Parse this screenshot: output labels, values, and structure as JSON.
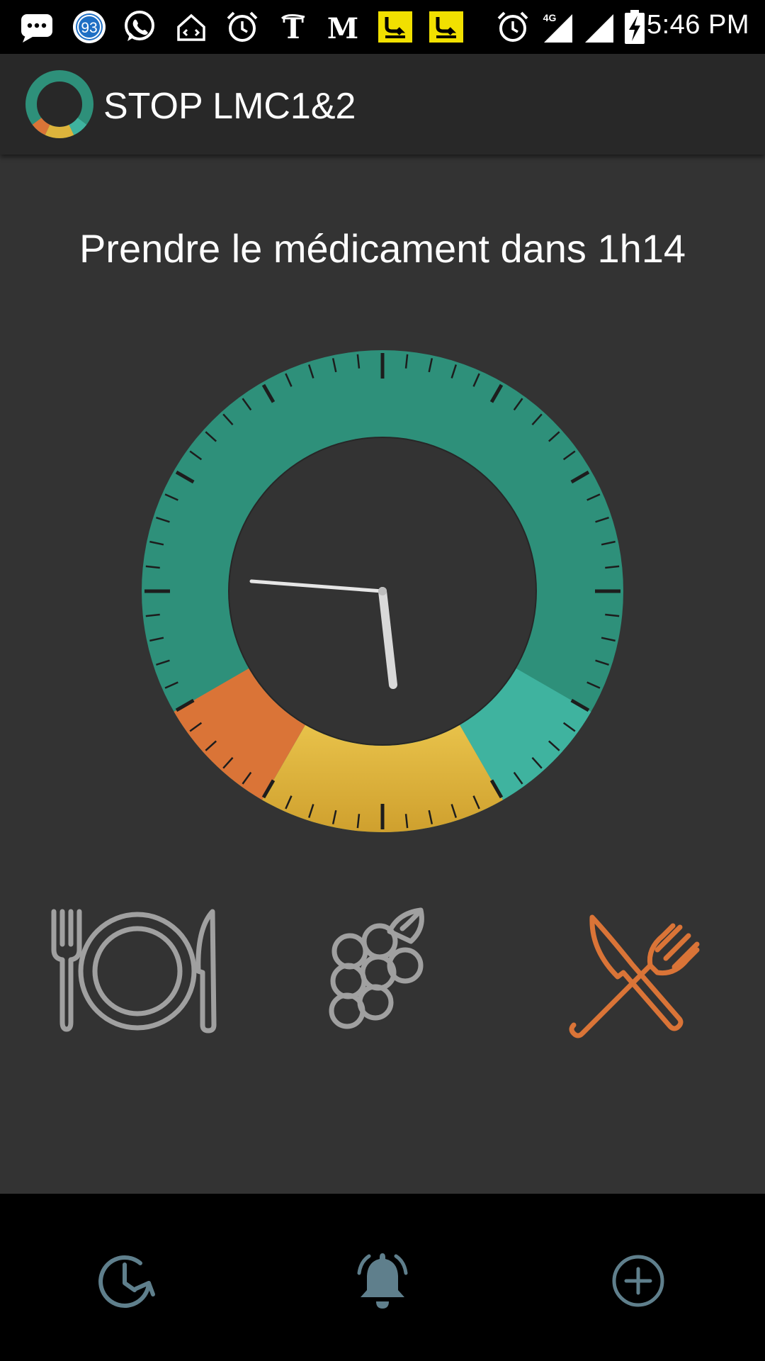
{
  "status_bar": {
    "time": "5:46 PM",
    "notification_badge": "93",
    "network": "4G",
    "icons": [
      "messaging-icon",
      "badge-93-icon",
      "whatsapp-icon",
      "home-icon",
      "alarm-icon",
      "nyt-icon",
      "lemonde-icon",
      "yellow-app-icon",
      "yellow-app-icon",
      "alarm-icon",
      "signal-4g-icon",
      "signal-icon",
      "battery-charging-icon"
    ]
  },
  "app_bar": {
    "title": "STOP LMC1&2",
    "logo_icon": "ring-logo-icon"
  },
  "main": {
    "headline": "Prendre le médicament dans 1h14",
    "dial": {
      "clock_time": "5:46",
      "colors": {
        "ring": "#2E907A",
        "segment_orange": "#DA7437",
        "segment_yellow": "#DDB43C",
        "segment_light_teal": "#3FB39F",
        "face": "#333333"
      }
    },
    "meal_icons": [
      {
        "name": "plate-cutlery-icon",
        "state": "inactive",
        "color": "#A0A0A0"
      },
      {
        "name": "grapes-icon",
        "state": "inactive",
        "color": "#A0A0A0"
      },
      {
        "name": "crossed-knife-fork-icon",
        "state": "active",
        "color": "#DA7437"
      }
    ]
  },
  "bottom_nav": {
    "color": "#5F7F8C",
    "items": [
      {
        "icon": "history-clock-icon"
      },
      {
        "icon": "bell-ringing-icon"
      },
      {
        "icon": "add-circle-icon"
      }
    ]
  }
}
